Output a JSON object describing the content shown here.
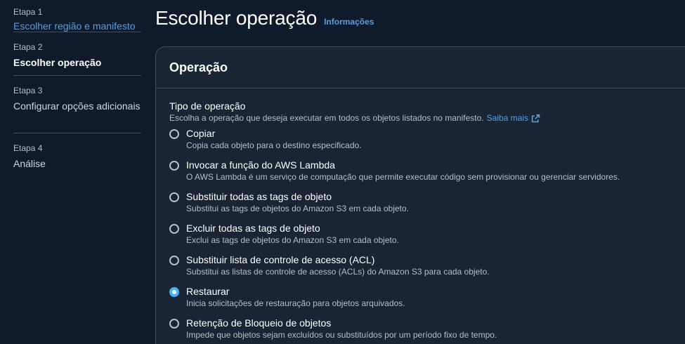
{
  "sidebar": {
    "steps": [
      {
        "label": "Etapa 1",
        "title": "Escolher região e manifesto"
      },
      {
        "label": "Etapa 2",
        "title": "Escolher operação"
      },
      {
        "label": "Etapa 3",
        "title": "Configurar opções adicionais"
      },
      {
        "label": "Etapa 4",
        "title": "Análise"
      }
    ]
  },
  "header": {
    "title": "Escolher operação",
    "info_link": "Informações"
  },
  "panel": {
    "title": "Operação",
    "field_label": "Tipo de operação",
    "field_description": "Escolha a operação que deseja executar em todos os objetos listados no manifesto.",
    "learn_more": "Saiba mais",
    "selected": "Restaurar",
    "options": [
      {
        "title": "Copiar",
        "description": "Copia cada objeto para o destino especificado."
      },
      {
        "title": "Invocar a função do AWS Lambda",
        "description": "O AWS Lambda é um serviço de computação que permite executar código sem provisionar ou gerenciar servidores."
      },
      {
        "title": "Substituir todas as tags de objeto",
        "description": "Substitui as tags de objetos do Amazon S3 em cada objeto."
      },
      {
        "title": "Excluir todas as tags de objeto",
        "description": "Exclui as tags de objetos do Amazon S3 em cada objeto."
      },
      {
        "title": "Substituir lista de controle de acesso (ACL)",
        "description": "Substitui as listas de controle de acesso (ACLs) do Amazon S3 para cada objeto."
      },
      {
        "title": "Restaurar",
        "description": "Inicia solicitações de restauração para objetos arquivados."
      },
      {
        "title": "Retenção de Bloqueio de objetos",
        "description": "Impede que objetos sejam excluídos ou substituídos por um período fixo de tempo."
      }
    ]
  },
  "colors": {
    "background": "#0f1b2a",
    "panel": "#192534",
    "link": "#539fe5",
    "radio_selected": "#42b4ff"
  }
}
